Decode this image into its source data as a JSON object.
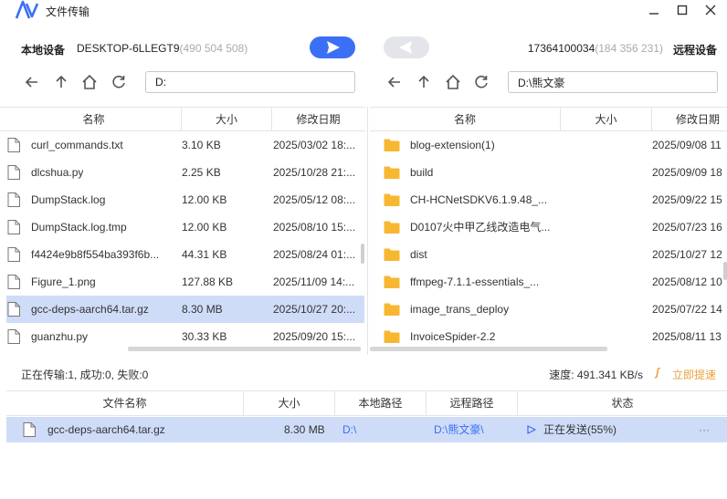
{
  "window": {
    "title": "文件传输"
  },
  "devices": {
    "local_label": "本地设备",
    "local_name": "DESKTOP-6LLEGT9",
    "local_ip": "(490 504 508)",
    "remote_id": "17364100034",
    "remote_ip": "(184 356 231)",
    "remote_label": "远程设备"
  },
  "local": {
    "path": "D:",
    "columns": [
      "名称",
      "大小",
      "修改日期"
    ],
    "files": [
      {
        "name": "curl_commands.txt",
        "size": "3.10 KB",
        "date": "2025/03/02 18:..."
      },
      {
        "name": "dlcshua.py",
        "size": "2.25 KB",
        "date": "2025/10/28 21:..."
      },
      {
        "name": "DumpStack.log",
        "size": "12.00 KB",
        "date": "2025/05/12 08:..."
      },
      {
        "name": "DumpStack.log.tmp",
        "size": "12.00 KB",
        "date": "2025/08/10 15:..."
      },
      {
        "name": "f4424e9b8f554ba393f6b...",
        "size": "44.31 KB",
        "date": "2025/08/24 01:..."
      },
      {
        "name": "Figure_1.png",
        "size": "127.88 KB",
        "date": "2025/11/09 14:..."
      },
      {
        "name": "gcc-deps-aarch64.tar.gz",
        "size": "8.30 MB",
        "date": "2025/10/27 20:..."
      },
      {
        "name": "guanzhu.py",
        "size": "30.33 KB",
        "date": "2025/09/20 15:..."
      }
    ]
  },
  "remote": {
    "path": "D:\\熊文豪",
    "columns": [
      "名称",
      "大小",
      "修改日期"
    ],
    "files": [
      {
        "name": "blog-extension(1)",
        "size": "",
        "date": "2025/09/08 11"
      },
      {
        "name": "build",
        "size": "",
        "date": "2025/09/09 18"
      },
      {
        "name": "CH-HCNetSDKV6.1.9.48_...",
        "size": "",
        "date": "2025/09/22 15"
      },
      {
        "name": "D0107火中甲乙线改造电气...",
        "size": "",
        "date": "2025/07/23 16"
      },
      {
        "name": "dist",
        "size": "",
        "date": "2025/10/27 12"
      },
      {
        "name": "ffmpeg-7.1.1-essentials_...",
        "size": "",
        "date": "2025/08/12 10"
      },
      {
        "name": "image_trans_deploy",
        "size": "",
        "date": "2025/07/22 14"
      },
      {
        "name": "InvoiceSpider-2.2",
        "size": "",
        "date": "2025/08/11 13"
      }
    ]
  },
  "status": {
    "text": "正在传输:1, 成功:0, 失败:0",
    "speed": "速度:  491.341 KB/s",
    "boost": "立即提速"
  },
  "queue": {
    "columns": [
      "文件名称",
      "大小",
      "本地路径",
      "远程路径",
      "状态"
    ],
    "rows": [
      {
        "name": "gcc-deps-aarch64.tar.gz",
        "size": "8.30 MB",
        "local_path": "D:\\",
        "remote_path": "D:\\熊文豪\\",
        "status": "正在发送(55%)",
        "more": "···"
      }
    ]
  },
  "colors": {
    "accent": "#3b6ff5",
    "selected": "#cfdcf8",
    "folder": "#f7b731",
    "boost": "#e8a33d"
  }
}
